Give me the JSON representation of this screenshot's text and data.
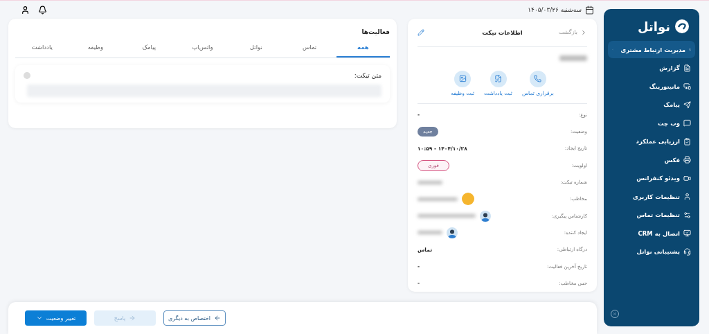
{
  "topbar": {
    "date": "سه‌شنبه ۱۴۰۵/۰۳/۲۶"
  },
  "sidebar": {
    "logo": "نواتل",
    "items": [
      {
        "label": "مدیریت ارتباط مشتری",
        "selected": true
      },
      {
        "label": "گزارش",
        "selected": false
      },
      {
        "label": "مانیتورینگ",
        "selected": false
      },
      {
        "label": "پیامک",
        "selected": false
      },
      {
        "label": "وب چت",
        "selected": false
      },
      {
        "label": "ارزیابی عملکرد",
        "selected": false
      },
      {
        "label": "فکس",
        "selected": false
      },
      {
        "label": "ویدئو کنفرانس",
        "selected": false
      },
      {
        "label": "تنظیمات کاربری",
        "selected": false
      },
      {
        "label": "تنظیمات تماس",
        "selected": false
      },
      {
        "label": "اتصال به CRM",
        "selected": false
      },
      {
        "label": "پشتیبانی نواتل",
        "selected": false
      }
    ]
  },
  "ticket": {
    "back": "بازگشت",
    "title": "اطلاعات تیکت",
    "actions": [
      {
        "label": "برقراری تماس"
      },
      {
        "label": "ثبت یادداشت"
      },
      {
        "label": "ثبت وظیفه"
      }
    ],
    "fields": [
      {
        "label": "نوع:",
        "kind": "text",
        "value": "-"
      },
      {
        "label": "وضعیت:",
        "kind": "status",
        "value": "جدید"
      },
      {
        "label": "تاریخ ایجاد:",
        "kind": "text",
        "value": "۱۴۰۴/۱۰/۲۸ - ۱۰:۵۹"
      },
      {
        "label": "اولویت:",
        "kind": "priority",
        "value": "فوری"
      },
      {
        "label": "شماره تیکت:",
        "kind": "hidden"
      },
      {
        "label": "مخاطب:",
        "kind": "contact"
      },
      {
        "label": "کارشناس پیگیری:",
        "kind": "person"
      },
      {
        "label": "ایجاد کننده:",
        "kind": "person"
      },
      {
        "label": "درگاه ارتباطی:",
        "kind": "text",
        "value": "تماس"
      },
      {
        "label": "تاریخ آخرین فعالیت:",
        "kind": "text",
        "value": "-"
      },
      {
        "label": "حس مخاطب:",
        "kind": "text",
        "value": "-"
      }
    ]
  },
  "activities": {
    "title": "فعالیت‌ها",
    "tabs": [
      {
        "label": "همه",
        "selected": true
      },
      {
        "label": "تماس",
        "selected": false
      },
      {
        "label": "نواتل",
        "selected": false
      },
      {
        "label": "واتس‌اپ",
        "selected": false
      },
      {
        "label": "پیامک",
        "selected": false
      },
      {
        "label": "وظیفه",
        "selected": false
      },
      {
        "label": "یادداشت",
        "selected": false
      }
    ],
    "ticket_text_label": "متن تیکت:"
  },
  "footer": {
    "buttons": [
      {
        "label": "اختصاص به دیگری",
        "kind": "outline",
        "disabled": false
      },
      {
        "label": "پاسخ",
        "kind": "soft",
        "disabled": true
      },
      {
        "label": "تغییر وضعیت",
        "kind": "primary",
        "disabled": false
      }
    ]
  }
}
